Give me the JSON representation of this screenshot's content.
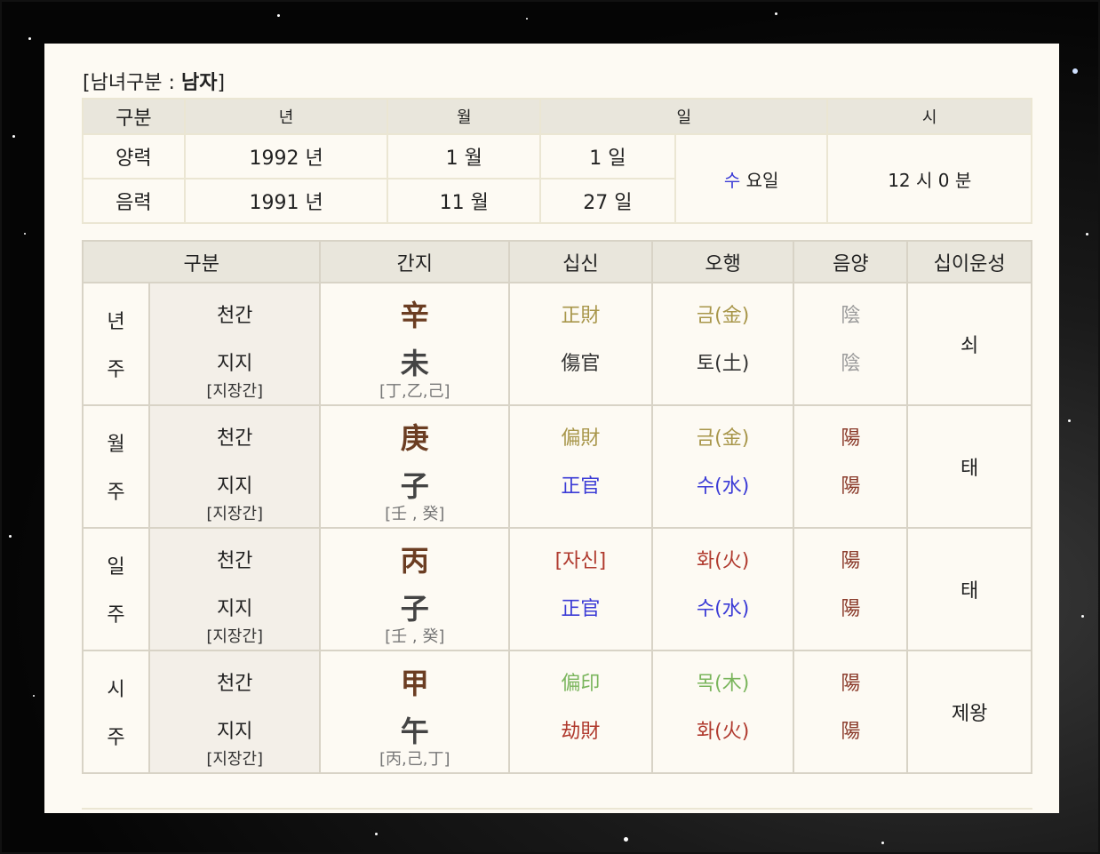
{
  "gender": {
    "label": "[남녀구분 : ",
    "value": "남자",
    "close": "]"
  },
  "calendar": {
    "headers": [
      "구분",
      "년",
      "월",
      "일",
      "시"
    ],
    "rows": [
      {
        "label": "양력",
        "year": "1992 년",
        "month": "1 월",
        "day": "1 일"
      },
      {
        "label": "음력",
        "year": "1991 년",
        "month": "11 월",
        "day": "27 일"
      }
    ],
    "weekday": {
      "char": "수",
      "suffix": " 요일"
    },
    "time": "12 시 0 분"
  },
  "pillars": {
    "headers": [
      "구분",
      "간지",
      "십신",
      "오행",
      "음양",
      "십이운성"
    ],
    "stem_label": "천간",
    "branch_label": "지지",
    "hidden_label": "[지장간]",
    "rows": [
      {
        "name1": "년",
        "name2": "주",
        "stem": "辛",
        "branch": "未",
        "hidden": "[丁,乙,己]",
        "stem_god": "正財",
        "branch_god": "傷官",
        "stem_element": "금(金)",
        "branch_element": "토(土)",
        "stem_yy": "陰",
        "branch_yy": "陰",
        "stage": "쇠"
      },
      {
        "name1": "월",
        "name2": "주",
        "stem": "庚",
        "branch": "子",
        "hidden": "[壬 , 癸]",
        "stem_god": "偏財",
        "branch_god": "正官",
        "stem_element": "금(金)",
        "branch_element": "수(水)",
        "stem_yy": "陽",
        "branch_yy": "陽",
        "stage": "태"
      },
      {
        "name1": "일",
        "name2": "주",
        "stem": "丙",
        "branch": "子",
        "hidden": "[壬 , 癸]",
        "stem_god": "[자신]",
        "branch_god": "正官",
        "stem_element": "화(火)",
        "branch_element": "수(水)",
        "stem_yy": "陽",
        "branch_yy": "陽",
        "stage": "태"
      },
      {
        "name1": "시",
        "name2": "주",
        "stem": "甲",
        "branch": "午",
        "hidden": "[丙,己,丁]",
        "stem_god": "偏印",
        "branch_god": "劫財",
        "stem_element": "목(木)",
        "branch_element": "화(火)",
        "stem_yy": "陽",
        "branch_yy": "陽",
        "stage": "제왕"
      }
    ]
  },
  "colors": {
    "panel_bg": "#fdfaf3",
    "header_bg": "#e9e6dc",
    "stem_brown": "#6b3d22",
    "metal_olive": "#a8964a",
    "water_blue": "#3b3bd6",
    "fire_red": "#b03a2e",
    "wood_green": "#7ab55c"
  }
}
